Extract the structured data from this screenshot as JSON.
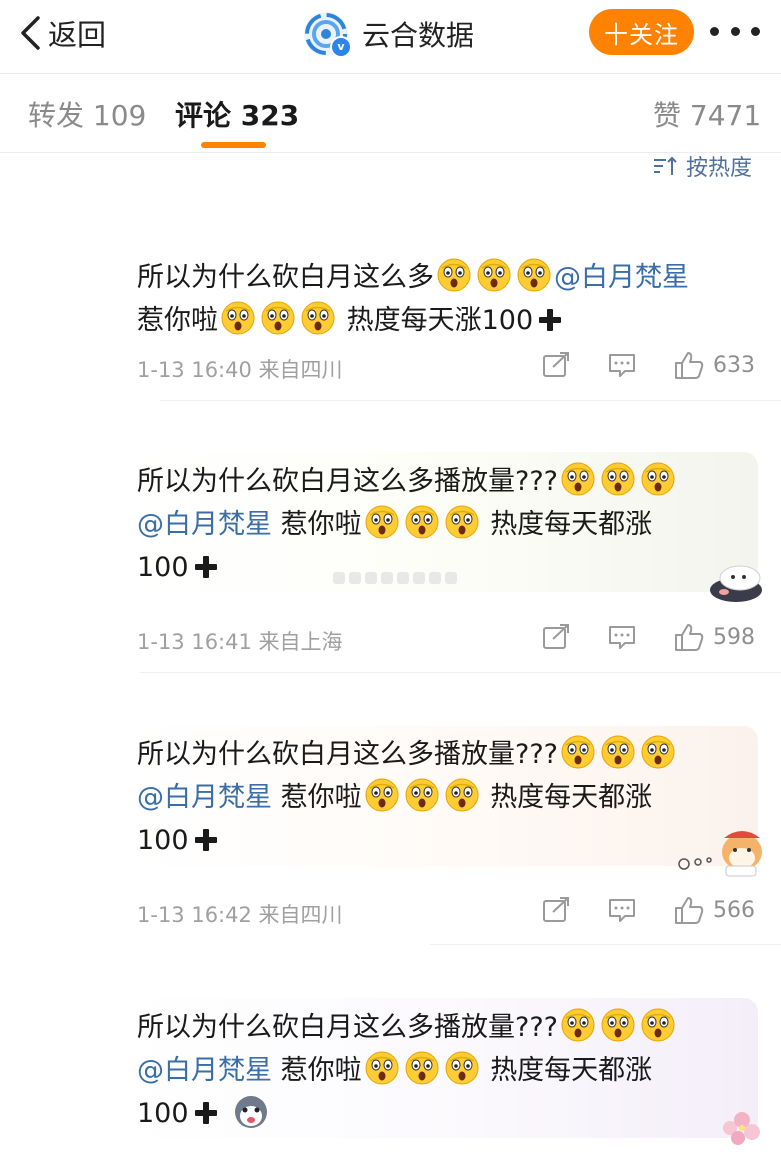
{
  "header": {
    "back_label": "返回",
    "account_name": "云合数据",
    "follow_label": "十关注"
  },
  "tabs": [
    {
      "label": "转发 109"
    },
    {
      "label": "评论 323"
    },
    {
      "label": "赞 7471"
    }
  ],
  "sort_label": "按热度",
  "comments": [
    {
      "seg1": "所以为什么砍白月这么多",
      "mention": "@白月梵星",
      "seg2": "惹你啦",
      "seg3": "热度每天涨100",
      "time": "1-13 16:40 来自四川",
      "likes": "633"
    },
    {
      "seg1": "所以为什么砍白月这么多播放量???",
      "mention": "@白月梵星",
      "seg2": "惹你啦",
      "seg3": "热度每天都涨",
      "seg4": "100",
      "time": "1-13 16:41 来自上海",
      "likes": "598"
    },
    {
      "seg1": "所以为什么砍白月这么多播放量???",
      "mention": "@白月梵星",
      "seg2": "惹你啦",
      "seg3": "热度每天都涨",
      "seg4": "100",
      "time": "1-13 16:42 来自四川",
      "likes": "566"
    },
    {
      "seg1": "所以为什么砍白月这么多播放量???",
      "mention": "@白月梵星",
      "seg2": "惹你啦",
      "seg3": "热度每天都涨",
      "seg4": "100"
    }
  ],
  "icons": {
    "back": "chevron-left-icon",
    "more": "more-dots-icon",
    "sort": "sort-icon",
    "emoji": "shocked-face-emoji",
    "plus": "heavy-plus-icon",
    "share": "share-icon",
    "reply": "comment-icon",
    "like": "thumbs-up-icon"
  },
  "colors": {
    "accent": "#ff8200",
    "mention": "#3a6ea8",
    "meta": "#a0a0a0"
  }
}
